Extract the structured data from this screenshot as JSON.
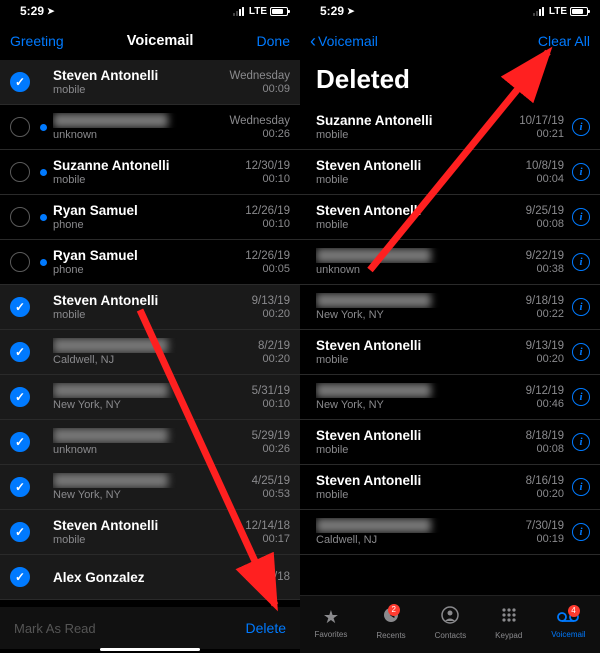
{
  "left": {
    "status": {
      "time": "5:29",
      "lte": "LTE"
    },
    "nav": {
      "greeting": "Greeting",
      "title": "Voicemail",
      "done": "Done"
    },
    "rows": [
      {
        "checked": true,
        "unread": false,
        "name": "Steven Antonelli",
        "sub": "mobile",
        "date": "Wednesday",
        "dur": "00:09",
        "blur": false
      },
      {
        "checked": false,
        "unread": true,
        "name": "████████████",
        "sub": "unknown",
        "date": "Wednesday",
        "dur": "00:26",
        "blur": true
      },
      {
        "checked": false,
        "unread": true,
        "name": "Suzanne Antonelli",
        "sub": "mobile",
        "date": "12/30/19",
        "dur": "00:10",
        "blur": false
      },
      {
        "checked": false,
        "unread": true,
        "name": "Ryan Samuel",
        "sub": "phone",
        "date": "12/26/19",
        "dur": "00:10",
        "blur": false
      },
      {
        "checked": false,
        "unread": true,
        "name": "Ryan Samuel",
        "sub": "phone",
        "date": "12/26/19",
        "dur": "00:05",
        "blur": false
      },
      {
        "checked": true,
        "unread": false,
        "name": "Steven Antonelli",
        "sub": "mobile",
        "date": "9/13/19",
        "dur": "00:20",
        "blur": false
      },
      {
        "checked": true,
        "unread": false,
        "name": "████████████",
        "sub": "Caldwell, NJ",
        "date": "8/2/19",
        "dur": "00:20",
        "blur": true
      },
      {
        "checked": true,
        "unread": false,
        "name": "████████████",
        "sub": "New York, NY",
        "date": "5/31/19",
        "dur": "00:10",
        "blur": true
      },
      {
        "checked": true,
        "unread": false,
        "name": "████████████",
        "sub": "unknown",
        "date": "5/29/19",
        "dur": "00:26",
        "blur": true
      },
      {
        "checked": true,
        "unread": false,
        "name": "████████████",
        "sub": "New York, NY",
        "date": "4/25/19",
        "dur": "00:53",
        "blur": true
      },
      {
        "checked": true,
        "unread": false,
        "name": "Steven Antonelli",
        "sub": "mobile",
        "date": "12/14/18",
        "dur": "00:17",
        "blur": false
      },
      {
        "checked": true,
        "unread": false,
        "name": "Alex Gonzalez",
        "sub": "",
        "date": "10/19/18",
        "dur": "",
        "blur": false
      }
    ],
    "toolbar": {
      "mark": "Mark As Read",
      "delete": "Delete"
    }
  },
  "right": {
    "status": {
      "time": "5:29",
      "lte": "LTE"
    },
    "nav": {
      "back": "Voicemail",
      "clear": "Clear All"
    },
    "title": "Deleted",
    "rows": [
      {
        "name": "Suzanne Antonelli",
        "sub": "mobile",
        "date": "10/17/19",
        "dur": "00:21",
        "blur": false
      },
      {
        "name": "Steven Antonelli",
        "sub": "mobile",
        "date": "10/8/19",
        "dur": "00:04",
        "blur": false
      },
      {
        "name": "Steven Antonelli",
        "sub": "mobile",
        "date": "9/25/19",
        "dur": "00:08",
        "blur": false
      },
      {
        "name": "████████████",
        "sub": "unknown",
        "date": "9/22/19",
        "dur": "00:38",
        "blur": true
      },
      {
        "name": "████████████",
        "sub": "New York, NY",
        "date": "9/18/19",
        "dur": "00:22",
        "blur": true
      },
      {
        "name": "Steven Antonelli",
        "sub": "mobile",
        "date": "9/13/19",
        "dur": "00:20",
        "blur": false
      },
      {
        "name": "████████████",
        "sub": "New York, NY",
        "date": "9/12/19",
        "dur": "00:46",
        "blur": true
      },
      {
        "name": "Steven Antonelli",
        "sub": "mobile",
        "date": "8/18/19",
        "dur": "00:08",
        "blur": false
      },
      {
        "name": "Steven Antonelli",
        "sub": "mobile",
        "date": "8/16/19",
        "dur": "00:20",
        "blur": false
      },
      {
        "name": "████████████",
        "sub": "Caldwell, NJ",
        "date": "7/30/19",
        "dur": "00:19",
        "blur": true
      }
    ],
    "tabs": {
      "favorites": "Favorites",
      "recents": "Recents",
      "recents_badge": "2",
      "contacts": "Contacts",
      "keypad": "Keypad",
      "voicemail": "Voicemail",
      "voicemail_badge": "4"
    }
  }
}
